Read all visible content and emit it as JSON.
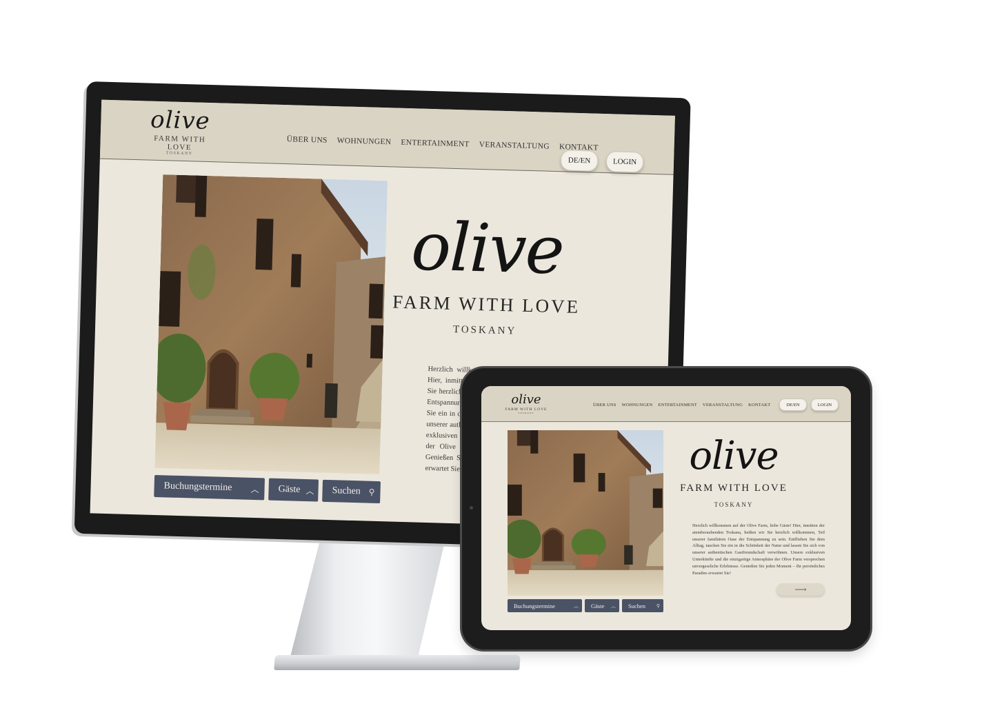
{
  "site": {
    "logo_script": "olive",
    "logo_tagline": "FARM WITH LOVE",
    "logo_region": "TOSKANY",
    "nav": [
      "ÜBER UNS",
      "WOHNUNGEN",
      "ENTERTAINMENT",
      "VERANSTALTUNG",
      "KONTAKT"
    ],
    "lang_button": "DE/EN",
    "login_button": "LOGIN",
    "hero_script": "olive",
    "hero_tagline": "FARM WITH LOVE",
    "hero_region": "TOSKANY",
    "booking": {
      "dates_label": "Buchungstermine",
      "guests_label": "Gäste",
      "search_label": "Suchen"
    },
    "welcome_text": "Herzlich willkommen auf der Olive Farm, liebe Gäste! Hier, inmitten der atemberaubenden Toskana, heißen wir Sie herzlich willkommen, Teil unserer familiären Oase der Entspannung zu sein. Entfliehen Sie dem Alltag, tauchen Sie ein in die Schönheit der Natur und lassen Sie sich von unserer authentischen Gastfreundschaft verwöhnen. Unsere exklusiven Unterkünfte und die einzigartige Atmosphäre der Olive Farm versprechen unvergessliche Erlebnisse. Genießen Sie jeden Moment – Ihr persönliches Paradies erwartet Sie!"
  },
  "icons": {
    "chevron": "chevron-up-icon",
    "search": "search-icon",
    "arrow": "arrow-right-icon"
  },
  "colors": {
    "header_bg": "#dad4c4",
    "page_bg": "#ece7dc",
    "booking_bg": "#4a5266"
  }
}
